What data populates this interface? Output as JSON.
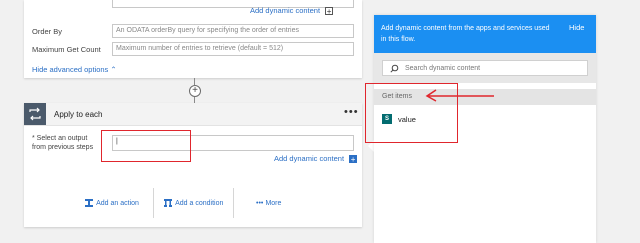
{
  "get_items": {
    "add_dynamic_content_label": "Add dynamic content",
    "fields": [
      {
        "label": "Order By",
        "placeholder": "An ODATA orderBy query for specifying the order of entries"
      },
      {
        "label": "Maximum Get Count",
        "placeholder": "Maximum number of entries to retrieve (default = 512)"
      }
    ],
    "hide_advanced_label": "Hide advanced options"
  },
  "apply_to_each": {
    "title": "Apply to each",
    "more_glyph": "•••",
    "field_label": "* Select an output from previous steps",
    "field_value": "|",
    "add_dynamic_content_label": "Add dynamic content",
    "actions": {
      "add_action": "Add an action",
      "add_condition": "Add a condition",
      "more": "More"
    }
  },
  "dynamic_panel": {
    "header_text": "Add dynamic content from the apps and services used in this flow.",
    "hide_label": "Hide",
    "search_placeholder": "Search dynamic content",
    "group_label": "Get items",
    "token_label": "value",
    "token_icon_letter": "S"
  },
  "colors": {
    "accent_blue": "#1b8ff2",
    "link_blue": "#2b6fc5",
    "annotation_red": "#e0262d",
    "header_dark": "#4b5a6b"
  }
}
